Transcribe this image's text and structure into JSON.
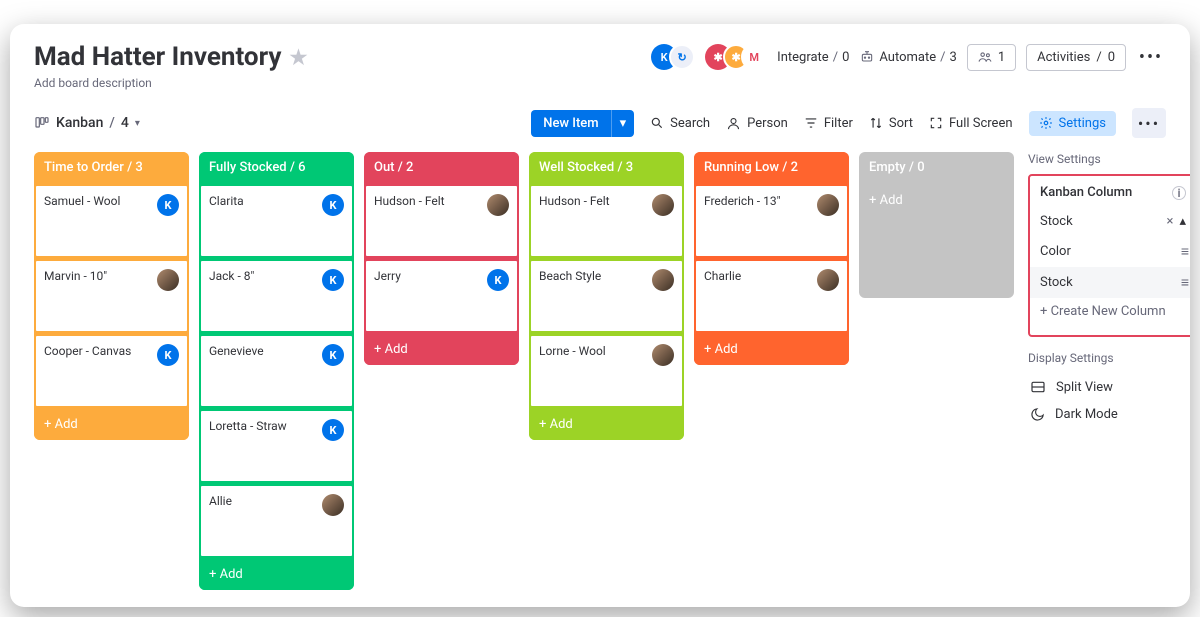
{
  "board": {
    "title": "Mad Hatter Inventory",
    "description": "Add board description"
  },
  "header": {
    "integrate_label": "Integrate",
    "integrate_count": "0",
    "automate_label": "Automate",
    "automate_count": "3",
    "presence_count": "1",
    "activities_label": "Activities",
    "activities_count": "0"
  },
  "view": {
    "name": "Kanban",
    "count": "4"
  },
  "toolbar": {
    "new_item": "New Item",
    "search": "Search",
    "person": "Person",
    "filter": "Filter",
    "sort": "Sort",
    "full_screen": "Full Screen",
    "settings": "Settings"
  },
  "columns": [
    {
      "name": "Time to Order",
      "count": "3",
      "color": "c-orange",
      "cards": [
        {
          "title": "Samuel - Wool",
          "avatar": "k"
        },
        {
          "title": "Marvin - 10\"",
          "avatar": "img"
        },
        {
          "title": "Cooper - Canvas",
          "avatar": "k"
        }
      ]
    },
    {
      "name": "Fully Stocked",
      "count": "6",
      "color": "c-green",
      "cards": [
        {
          "title": "Clarita",
          "avatar": "k"
        },
        {
          "title": "Jack - 8\"",
          "avatar": "k"
        },
        {
          "title": "Genevieve",
          "avatar": "k"
        },
        {
          "title": "Loretta - Straw",
          "avatar": "k"
        },
        {
          "title": "Allie",
          "avatar": "img"
        }
      ]
    },
    {
      "name": "Out",
      "count": "2",
      "color": "c-red",
      "cards": [
        {
          "title": "Hudson - Felt",
          "avatar": "img"
        },
        {
          "title": "Jerry",
          "avatar": "k"
        }
      ]
    },
    {
      "name": "Well Stocked",
      "count": "3",
      "color": "c-lime",
      "cards": [
        {
          "title": "Hudson - Felt",
          "avatar": "img"
        },
        {
          "title": "Beach Style",
          "avatar": "img"
        },
        {
          "title": "Lorne - Wool",
          "avatar": "img"
        }
      ]
    },
    {
      "name": "Running Low",
      "count": "2",
      "color": "c-deep",
      "cards": [
        {
          "title": "Frederich - 13\"",
          "avatar": "img"
        },
        {
          "title": "Charlie",
          "avatar": "img"
        }
      ]
    },
    {
      "name": "Empty",
      "count": "0",
      "color": "empty",
      "cards": []
    }
  ],
  "add_label": "+ Add",
  "settings_panel": {
    "view_heading": "View Settings",
    "kanban_column_label": "Kanban Column",
    "selected_column": "Stock",
    "options": [
      "Color",
      "Stock"
    ],
    "create_new": "+ Create New Column",
    "display_heading": "Display Settings",
    "split_view": "Split View",
    "dark_mode": "Dark Mode"
  }
}
